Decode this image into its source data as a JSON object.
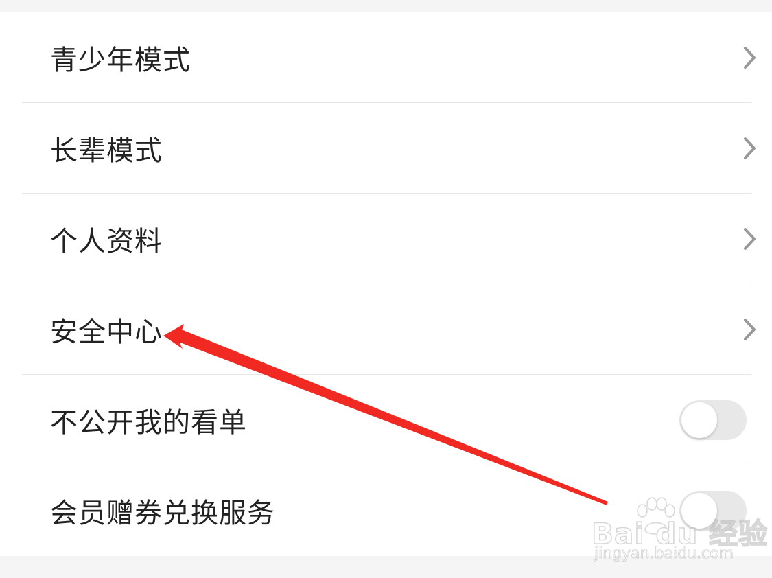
{
  "settings": {
    "items": [
      {
        "label": "青少年模式",
        "control": "chevron"
      },
      {
        "label": "长辈模式",
        "control": "chevron"
      },
      {
        "label": "个人资料",
        "control": "chevron"
      },
      {
        "label": "安全中心",
        "control": "chevron"
      },
      {
        "label": "不公开我的看单",
        "control": "toggle",
        "on": false
      },
      {
        "label": "会员赠券兑换服务",
        "control": "toggle",
        "on": false
      }
    ]
  },
  "annotation": {
    "arrow_color": "#f02a23",
    "points_to": "安全中心"
  },
  "watermark": {
    "logo_text": "Bai du 经验",
    "url": "jingyan.baidu.com"
  },
  "colors": {
    "background": "#f5f5f5",
    "list_background": "#ffffff",
    "text": "#222222",
    "chevron": "#999999",
    "toggle_off": "#e8e8e8"
  }
}
